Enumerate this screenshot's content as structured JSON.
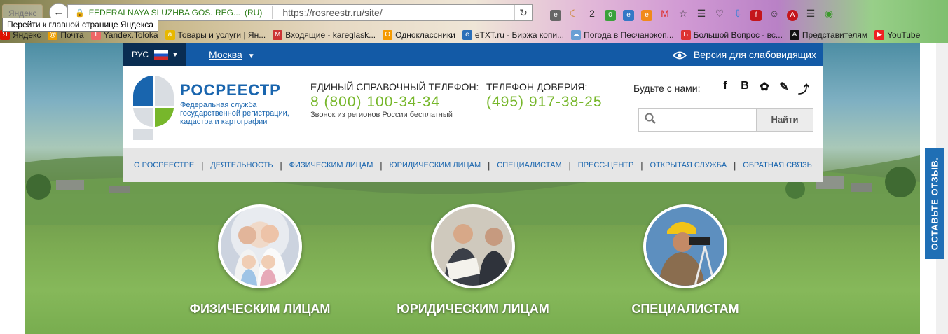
{
  "browser": {
    "tab_title": "Яндекс",
    "tooltip": "Перейти к главной странице Яндекса",
    "site_name": "FEDERALNAYA SLUZHBA GOS. REG...",
    "region": "(RU)",
    "url": "https://rosreestr.ru/site/",
    "badge_count": "2",
    "bookmarks": [
      "Яндекс",
      "Почта",
      "Yandex.Toloka",
      "Товары и услуги | Ян...",
      "Входящие - kareglask...",
      "Одноклассники",
      "eTXT.ru - Биржа копи...",
      "Погода в Песчанокоп...",
      "Большой Вопрос - вс...",
      "Представителям",
      "YouTube"
    ]
  },
  "topbar": {
    "lang": "РУС",
    "city": "Москва",
    "vision": "Версия для слабовидящих"
  },
  "header": {
    "brand": "РОСРЕЕСТР",
    "brand_sub": "Федеральная служба государственной регистрации, кадастра и картографии",
    "phone1_label": "ЕДИНЫЙ СПРАВОЧНЫЙ ТЕЛЕФОН:",
    "phone1": "8 (800) 100-34-34",
    "phone1_note": "Звонок из регионов России бесплатный",
    "phone2_label": "ТЕЛЕФОН ДОВЕРИЯ:",
    "phone2": "(495) 917-38-25",
    "social_label": "Будьте с нами:",
    "search_button": "Найти",
    "search_placeholder": ""
  },
  "menu": [
    "О РОСРЕЕСТРЕ",
    "ДЕЯТЕЛЬНОСТЬ",
    "ФИЗИЧЕСКИМ ЛИЦАМ",
    "ЮРИДИЧЕСКИМ ЛИЦАМ",
    "СПЕЦИАЛИСТАМ",
    "ПРЕСС-ЦЕНТР",
    "ОТКРЫТАЯ СЛУЖБА",
    "ОБРАТНАЯ СВЯЗЬ"
  ],
  "categories": [
    "ФИЗИЧЕСКИМ ЛИЦАМ",
    "ЮРИДИЧЕСКИМ ЛИЦАМ",
    "СПЕЦИАЛИСТАМ"
  ],
  "feedback": "ОСТАВЬТЕ ОТЗЫВ.",
  "colors": {
    "brand_blue": "#1965ae",
    "accent_green": "#77b72b",
    "strip": "#135aa6"
  }
}
